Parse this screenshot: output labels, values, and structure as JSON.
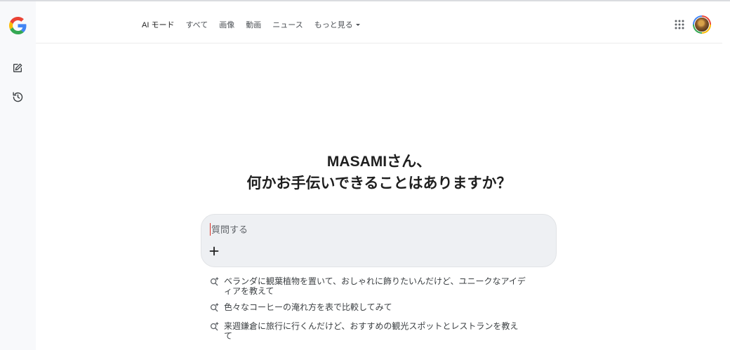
{
  "nav": {
    "items": [
      {
        "label": "AI モード",
        "active": true
      },
      {
        "label": "すべて"
      },
      {
        "label": "画像"
      },
      {
        "label": "動画"
      },
      {
        "label": "ニュース"
      },
      {
        "label": "もっと見る",
        "has_dropdown": true
      }
    ]
  },
  "rail": {
    "icons": [
      "google-logo",
      "new-chat-icon",
      "history-icon"
    ]
  },
  "greeting": {
    "line1": "MASAMIさん、",
    "line2": "何かお手伝いできることはありますか？"
  },
  "ask": {
    "placeholder": "質問する",
    "value": ""
  },
  "suggestions": [
    "ベランダに観葉植物を置いて、おしゃれに飾りたいんだけど、ユニークなアイディアを教えて",
    "色々なコーヒーの淹れ方を表で比較してみて",
    "来週鎌倉に旅行に行くんだけど、おすすめの観光スポットとレストランを教えて"
  ],
  "colors": {
    "rail_bg": "#f8f9fb",
    "askbox_bg": "#eef0f3",
    "text": "#1f1f1f",
    "caret_red": "#d93025"
  }
}
